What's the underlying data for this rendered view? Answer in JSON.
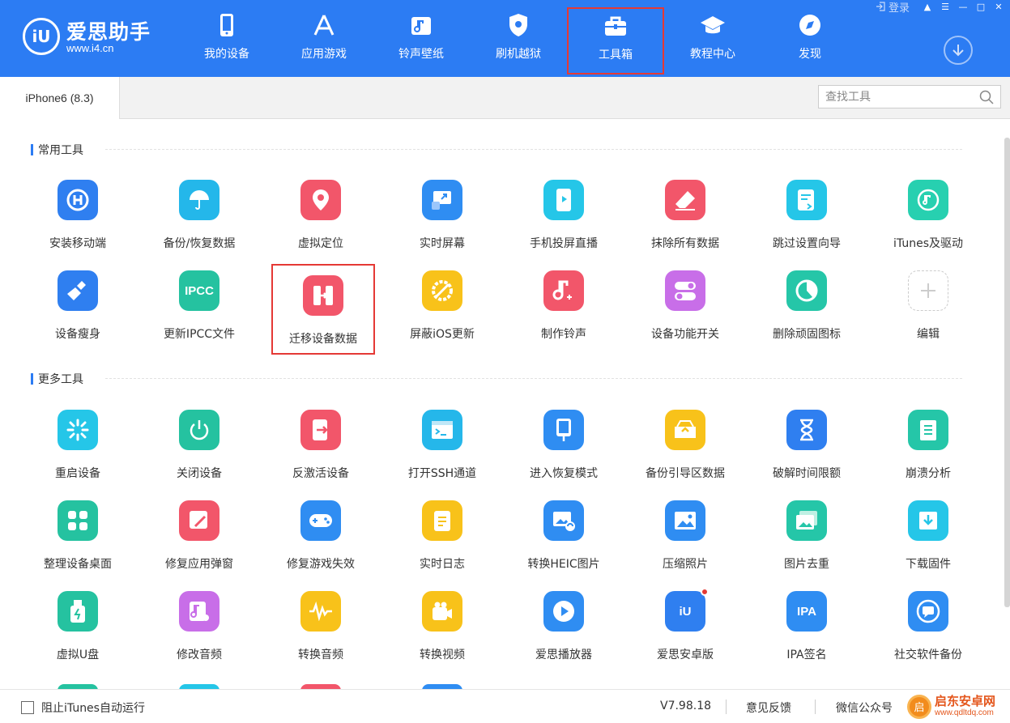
{
  "app": {
    "logo_mark": "iU",
    "name": "爱思助手",
    "url": "www.i4.cn"
  },
  "nav": [
    {
      "label": "我的设备",
      "icon": "phone-icon"
    },
    {
      "label": "应用游戏",
      "icon": "app-store-icon"
    },
    {
      "label": "铃声壁纸",
      "icon": "music-icon"
    },
    {
      "label": "刷机越狱",
      "icon": "shield-icon"
    },
    {
      "label": "工具箱",
      "icon": "toolbox-icon",
      "active": true
    },
    {
      "label": "教程中心",
      "icon": "graduation-cap-icon"
    },
    {
      "label": "发现",
      "icon": "compass-icon"
    }
  ],
  "window": {
    "login": "登录"
  },
  "device_tab": "iPhone6 (8.3)",
  "search": {
    "placeholder": "查找工具"
  },
  "sections": {
    "common": "常用工具",
    "more": "更多工具"
  },
  "common_tools": [
    {
      "label": "安装移动端",
      "icon": "install-mobile-icon",
      "color": "#2f7ff0"
    },
    {
      "label": "备份/恢复数据",
      "icon": "umbrella-icon",
      "color": "#24b7ea"
    },
    {
      "label": "虚拟定位",
      "icon": "location-pin-icon",
      "color": "#f2566a"
    },
    {
      "label": "实时屏幕",
      "icon": "screen-share-icon",
      "color": "#2f8df2"
    },
    {
      "label": "手机投屏直播",
      "icon": "phone-cast-icon",
      "color": "#25c6e8"
    },
    {
      "label": "抹除所有数据",
      "icon": "eraser-icon",
      "color": "#f2566a"
    },
    {
      "label": "跳过设置向导",
      "icon": "skip-setup-icon",
      "color": "#25c6e8"
    },
    {
      "label": "iTunes及驱动",
      "icon": "itunes-icon",
      "color": "#27d0b0"
    },
    {
      "label": "设备瘦身",
      "icon": "broom-icon",
      "color": "#2f7ff0"
    },
    {
      "label": "更新IPCC文件",
      "icon": "ipcc-icon",
      "icon_text": "IPCC",
      "color": "#25c2a0"
    },
    {
      "label": "迁移设备数据",
      "icon": "migrate-data-icon",
      "color": "#f2566a",
      "highlight": true
    },
    {
      "label": "屏蔽iOS更新",
      "icon": "block-update-icon",
      "color": "#f8c21a"
    },
    {
      "label": "制作铃声",
      "icon": "ringtone-icon",
      "color": "#f2566a"
    },
    {
      "label": "设备功能开关",
      "icon": "toggle-icon",
      "color": "#c86ee8"
    },
    {
      "label": "删除顽固图标",
      "icon": "pie-icon",
      "color": "#25c6a8"
    },
    {
      "label": "编辑",
      "icon": "plus-icon",
      "color": "#ffffff"
    }
  ],
  "more_tools": [
    {
      "label": "重启设备",
      "icon": "restart-icon",
      "color": "#25c6e8"
    },
    {
      "label": "关闭设备",
      "icon": "power-icon",
      "color": "#25c2a0"
    },
    {
      "label": "反激活设备",
      "icon": "deactivate-icon",
      "color": "#f2566a"
    },
    {
      "label": "打开SSH通道",
      "icon": "terminal-icon",
      "color": "#25b7ea"
    },
    {
      "label": "进入恢复模式",
      "icon": "recovery-mode-icon",
      "color": "#2f8df2"
    },
    {
      "label": "备份引导区数据",
      "icon": "boot-backup-icon",
      "color": "#f8c21a"
    },
    {
      "label": "破解时间限额",
      "icon": "hourglass-icon",
      "color": "#2f7ff0"
    },
    {
      "label": "崩溃分析",
      "icon": "crash-log-icon",
      "color": "#25c6a8"
    },
    {
      "label": "整理设备桌面",
      "icon": "grid-icon",
      "color": "#25c2a0"
    },
    {
      "label": "修复应用弹窗",
      "icon": "repair-app-icon",
      "color": "#f2566a"
    },
    {
      "label": "修复游戏失效",
      "icon": "gamepad-icon",
      "color": "#2f8df2"
    },
    {
      "label": "实时日志",
      "icon": "log-icon",
      "color": "#f8c21a"
    },
    {
      "label": "转换HEIC图片",
      "icon": "heic-convert-icon",
      "color": "#2f8df2"
    },
    {
      "label": "压缩照片",
      "icon": "image-icon",
      "color": "#2f8df2"
    },
    {
      "label": "图片去重",
      "icon": "duplicate-image-icon",
      "color": "#25c6a8"
    },
    {
      "label": "下载固件",
      "icon": "download-firmware-icon",
      "color": "#25c6e8"
    },
    {
      "label": "虚拟U盘",
      "icon": "usb-drive-icon",
      "color": "#25c2a0"
    },
    {
      "label": "修改音频",
      "icon": "audio-edit-icon",
      "color": "#c86ee8"
    },
    {
      "label": "转换音频",
      "icon": "waveform-icon",
      "color": "#f8c21a"
    },
    {
      "label": "转换视频",
      "icon": "video-convert-icon",
      "color": "#f8c21a"
    },
    {
      "label": "爱思播放器",
      "icon": "play-icon",
      "color": "#2f8df2"
    },
    {
      "label": "爱思安卓版",
      "icon": "i4-android-icon",
      "icon_text": "iU",
      "color": "#2f7ff0",
      "badge": true
    },
    {
      "label": "IPA签名",
      "icon": "ipa-sign-icon",
      "icon_text": "IPA",
      "color": "#2f8df2"
    },
    {
      "label": "社交软件备份",
      "icon": "chat-backup-icon",
      "color": "#2f8df2"
    }
  ],
  "footer": {
    "itunes_label": "阻止iTunes自动运行",
    "version": "V7.98.18",
    "feedback": "意见反馈",
    "wechat": "微信公众号"
  },
  "watermark": {
    "mark": "启",
    "title": "启东安卓网",
    "url": "www.qdltdq.com"
  },
  "colors": {
    "primary": "#2c7cf3",
    "highlight": "#e53935"
  }
}
